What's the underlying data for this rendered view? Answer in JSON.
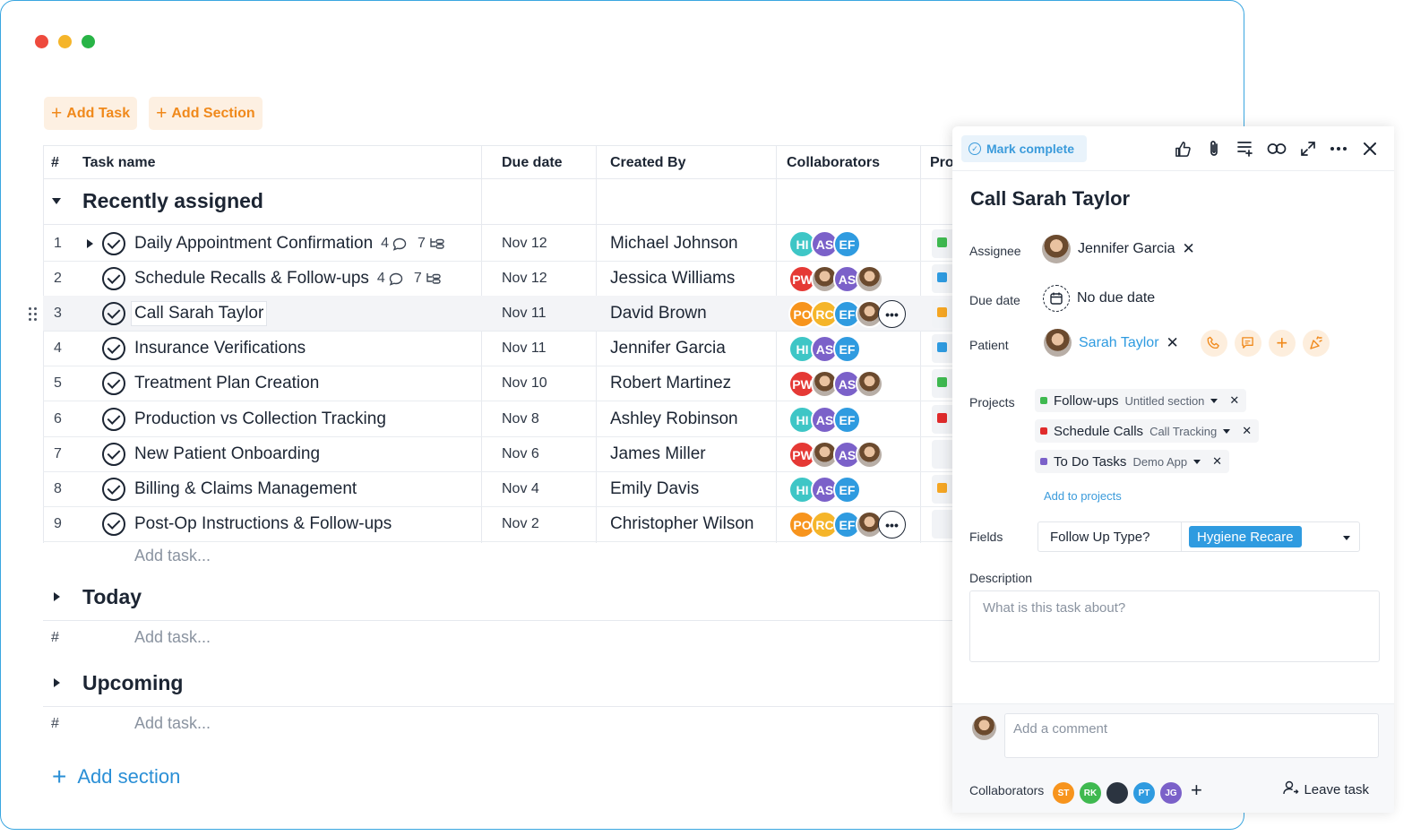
{
  "toolbar": {
    "add_task": "Add Task",
    "add_section": "Add Section"
  },
  "columns": {
    "num": "#",
    "task": "Task name",
    "due": "Due date",
    "created": "Created By",
    "collab": "Collaborators",
    "proj": "Pro"
  },
  "sections": {
    "recent": "Recently assigned",
    "today": "Today",
    "upcoming": "Upcoming",
    "add_task": "Add task...",
    "hash": "#",
    "add_section": "Add section"
  },
  "rows": [
    {
      "num": "1",
      "name": "Daily Appointment Confirmation",
      "comments": "4",
      "subtasks": "7",
      "due": "Nov 12",
      "creator": "Michael Johnson",
      "proj_color": "#3fb950",
      "avatars": [
        "HI",
        "AS",
        "EF"
      ]
    },
    {
      "num": "2",
      "name": "Schedule Recalls & Follow-ups",
      "comments": "4",
      "subtasks": "7",
      "due": "Nov 12",
      "creator": "Jessica Williams",
      "proj_color": "#2f9be0",
      "avatars": [
        "PW",
        "photo",
        "AS",
        "photo"
      ]
    },
    {
      "num": "3",
      "name": "Call Sarah Taylor",
      "due": "Nov 11",
      "creator": "David Brown",
      "proj_color": "#f5a623",
      "avatars": [
        "PO",
        "RC",
        "EF",
        "photo",
        "more"
      ]
    },
    {
      "num": "4",
      "name": "Insurance Verifications",
      "due": "Nov 11",
      "creator": "Jennifer Garcia",
      "proj_color": "#2f9be0",
      "avatars": [
        "HI",
        "AS",
        "EF"
      ]
    },
    {
      "num": "5",
      "name": "Treatment Plan Creation",
      "due": "Nov 10",
      "creator": "Robert Martinez",
      "proj_color": "#3fb950",
      "avatars": [
        "PW",
        "photo",
        "AS",
        "photo"
      ]
    },
    {
      "num": "6",
      "name": "Production vs Collection Tracking",
      "due": "Nov 8",
      "creator": "Ashley Robinson",
      "proj_color": "#e02b2b",
      "avatars": [
        "HI",
        "AS",
        "EF"
      ]
    },
    {
      "num": "7",
      "name": "New Patient Onboarding",
      "due": "Nov 6",
      "creator": "James Miller",
      "proj_color": "",
      "avatars": [
        "PW",
        "photo",
        "AS",
        "photo"
      ]
    },
    {
      "num": "8",
      "name": "Billing & Claims Management",
      "due": "Nov 4",
      "creator": "Emily Davis",
      "proj_color": "#f5a623",
      "avatars": [
        "HI",
        "AS",
        "EF"
      ]
    },
    {
      "num": "9",
      "name": "Post-Op Instructions & Follow-ups",
      "due": "Nov 2",
      "creator": "Christopher Wilson",
      "proj_color": "",
      "avatars": [
        "PO",
        "RC",
        "EF",
        "photo",
        "more"
      ]
    }
  ],
  "avatar_colors": {
    "HI": "#3ec6c6",
    "AS": "#7b61c9",
    "EF": "#2f9be0",
    "PW": "#e53935",
    "PO": "#f7941d",
    "RC": "#f5b52a"
  },
  "panel": {
    "mark_complete": "Mark complete",
    "title": "Call Sarah Taylor",
    "assignee_label": "Assignee",
    "assignee": "Jennifer Garcia",
    "due_label": "Due date",
    "due": "No due date",
    "patient_label": "Patient",
    "patient": "Sarah Taylor",
    "projects_label": "Projects",
    "projects": [
      {
        "name": "Follow-ups",
        "sub": "Untitled section",
        "color": "#3fb950"
      },
      {
        "name": "Schedule Calls",
        "sub": "Call Tracking",
        "color": "#e02b2b"
      },
      {
        "name": "To Do Tasks",
        "sub": "Demo App",
        "color": "#7b61c9"
      }
    ],
    "add_to_projects": "Add to projects",
    "fields_label": "Fields",
    "field_key": "Follow Up Type?",
    "field_value": "Hygiene Recare",
    "description_label": "Description",
    "description_placeholder": "What is this task about?",
    "comment_placeholder": "Add a comment",
    "collaborators_label": "Collaborators",
    "collaborators": [
      {
        "initials": "ST",
        "color": "#f7941d"
      },
      {
        "initials": "RK",
        "color": "#3fb950"
      },
      {
        "initials": "",
        "color": "#2b3440"
      },
      {
        "initials": "PT",
        "color": "#2f9be0"
      },
      {
        "initials": "JG",
        "color": "#7b61c9"
      }
    ],
    "leave_task": "Leave task"
  }
}
